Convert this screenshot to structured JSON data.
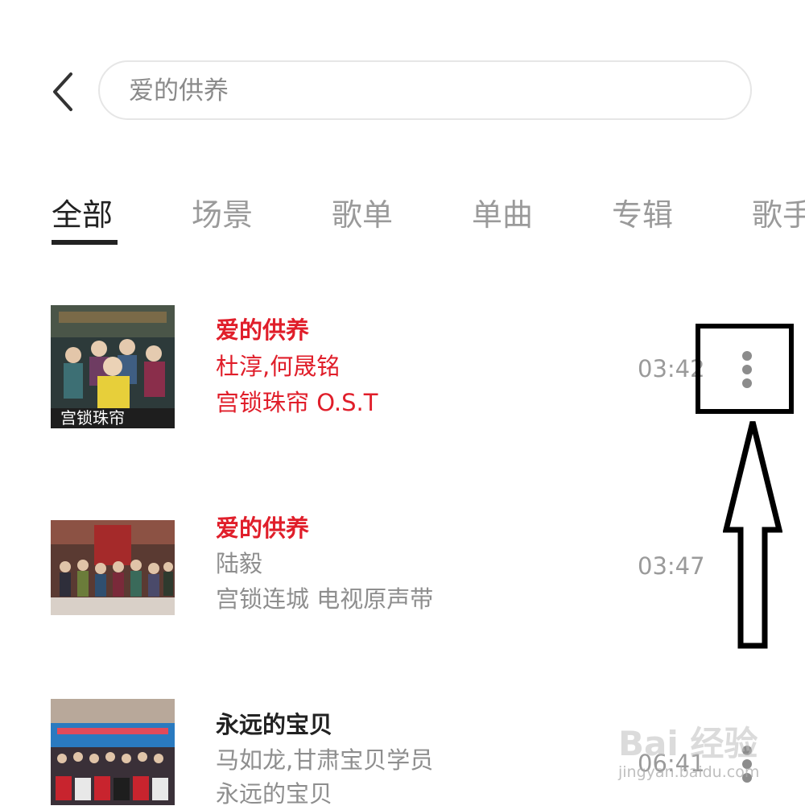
{
  "header": {
    "back_icon": "chevron-left-icon",
    "search_value": "爱的供养"
  },
  "tabs": [
    {
      "label": "全部",
      "active": true
    },
    {
      "label": "场景",
      "active": false
    },
    {
      "label": "歌单",
      "active": false
    },
    {
      "label": "单曲",
      "active": false
    },
    {
      "label": "专辑",
      "active": false
    },
    {
      "label": "歌手",
      "active": false
    }
  ],
  "songs": [
    {
      "title": "爱的供养",
      "artist": "杜淳,何晟铭",
      "album": "宫锁珠帘 O.S.T",
      "duration": "03:42",
      "highlighted": true
    },
    {
      "title": "爱的供养",
      "artist": "陆毅",
      "album": "宫锁连城 电视原声带",
      "duration": "03:47",
      "highlighted": false
    },
    {
      "title": "永远的宝贝",
      "artist": "马如龙,甘肃宝贝学员",
      "album": "永远的宝贝",
      "duration": "06:41",
      "highlighted": false
    }
  ],
  "cover_art_text": "宫锁珠帘",
  "more_icon": "vertical-ellipsis-icon",
  "annotation": {
    "arrow_icon": "up-arrow-icon",
    "frame": "highlight-box"
  },
  "watermark": {
    "brand": "Bai 经验",
    "url": "jingyan.baidu.com"
  },
  "colors": {
    "accent_red": "#e01e2a",
    "text_dark": "#222222",
    "text_gray": "#8e8e8e"
  }
}
